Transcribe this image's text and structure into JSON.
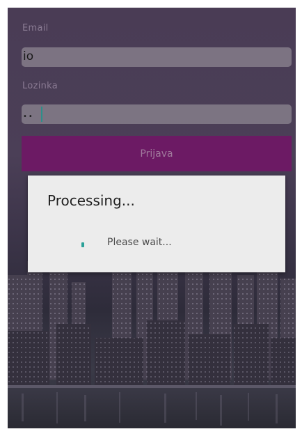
{
  "form": {
    "email_label": "Email",
    "email_value": "io",
    "password_label": "Lozinka",
    "password_value": "••",
    "login_label": "Prijava"
  },
  "dialog": {
    "title": "Processing...",
    "message": "Please wait..."
  },
  "colors": {
    "login_button": "#6c1a64",
    "spinner": "#2aa198",
    "dialog_bg": "#ececec"
  },
  "background": {
    "image": "city-skyline"
  }
}
